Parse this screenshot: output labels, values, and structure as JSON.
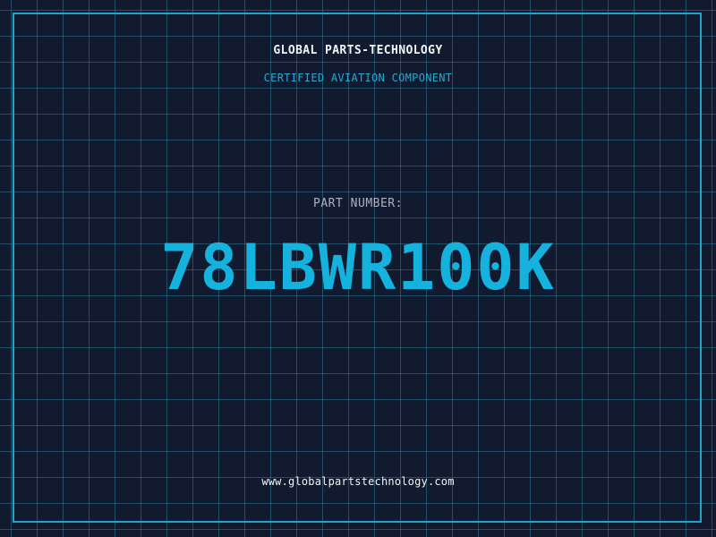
{
  "header": {
    "company": "GLOBAL PARTS-TECHNOLOGY",
    "subtitle": "CERTIFIED AVIATION COMPONENT"
  },
  "part": {
    "label": "PART NUMBER:",
    "number": "78LBWR100K"
  },
  "footer": {
    "website": "www.globalpartstechnology.com"
  },
  "colors": {
    "background": "#111a2e",
    "grid": "#2b7a96",
    "accent": "#16b2de",
    "frame": "#22a4c9",
    "text_primary": "#f2f4f7",
    "text_muted": "#aab3c2"
  }
}
